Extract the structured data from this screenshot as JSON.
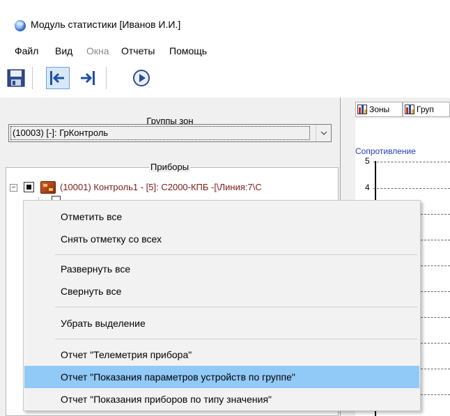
{
  "window": {
    "title": "Модуль статистики [Иванов И.И.]"
  },
  "menu": [
    {
      "label": "Файл",
      "disabled": false
    },
    {
      "label": "Вид",
      "disabled": false
    },
    {
      "label": "Окна",
      "disabled": true
    },
    {
      "label": "Отчеты",
      "disabled": false
    },
    {
      "label": "Помощь",
      "disabled": false
    }
  ],
  "toolbar": {
    "icons": [
      "save-icon",
      "arrow-left-icon",
      "arrow-right-icon",
      "play-icon"
    ]
  },
  "zone_groups": {
    "label": "Группы зон",
    "selected": "(10003) [-]: ГрКонтроль"
  },
  "devices": {
    "label": "Приборы",
    "row1": {
      "expander": "−",
      "text": "(10001) Контроль1 - [5]: С2000-КПБ -[\\Линия:7\\С"
    }
  },
  "tabs": [
    {
      "label": "Зоны"
    },
    {
      "label": "Груп"
    }
  ],
  "chart": {
    "title": "Сопротивление",
    "y_ticks": [
      "5",
      "4"
    ]
  },
  "context_menu": {
    "items": [
      "Отметить все",
      "Снять отметку со всех",
      "Развернуть все",
      "Свернуть все",
      "Убрать выделение",
      "Отчет \"Телеметрия прибора\"",
      "Отчет \"Показания параметров устройств по группе\"",
      "Отчет \"Показания приборов по типу значения\""
    ],
    "highlighted_index": 6
  },
  "colors": {
    "highlight": "#91c9f7",
    "chart_title": "#1f3fb8",
    "device_text": "#7a1a1a"
  }
}
